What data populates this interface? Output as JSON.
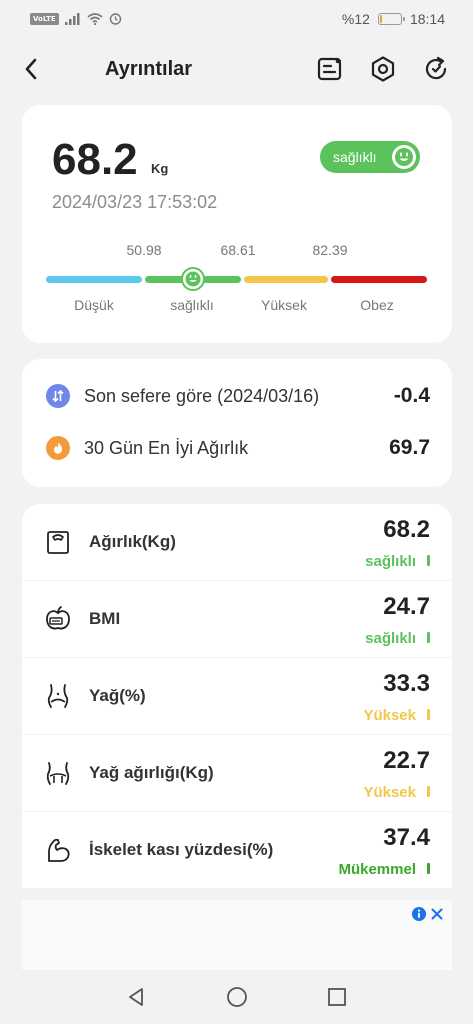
{
  "status_bar": {
    "network_badge": "VoLTE",
    "battery_text": "%12",
    "battery_level": 0.12,
    "time": "18:14"
  },
  "header": {
    "title": "Ayrıntılar",
    "icons": [
      "back-icon",
      "report-icon",
      "settings-hex-icon",
      "refresh-icon"
    ]
  },
  "summary": {
    "weight": "68.2",
    "unit": "Kg",
    "status_label": "sağlıklı",
    "datetime": "2024/03/23 17:53:02",
    "thresholds": [
      "50.98",
      "68.61",
      "82.39"
    ],
    "categories": [
      "Düşük",
      "sağlıklı",
      "Yüksek",
      "Obez"
    ],
    "category_colors": [
      "#5ec8ee",
      "#5cc25c",
      "#f2c64a",
      "#d41616"
    ],
    "marker_category": "sağlıklı",
    "marker_position": 0.5
  },
  "comparison": {
    "rows": [
      {
        "label": "Son sefere göre (2024/03/16)",
        "value": "-0.4",
        "icon": "compare-icon",
        "icon_color": "#6f86ea"
      },
      {
        "label": "30 Gün En İyi Ağırlık",
        "value": "69.7",
        "icon": "best-weight-icon",
        "icon_color": "#f39a3a"
      }
    ]
  },
  "metrics": [
    {
      "name": "Ağırlık(Kg)",
      "value": "68.2",
      "status": "sağlıklı",
      "status_color": "#5cc25c",
      "icon": "scale-icon"
    },
    {
      "name": "BMI",
      "value": "24.7",
      "status": "sağlıklı",
      "status_color": "#5cc25c",
      "icon": "bmi-icon"
    },
    {
      "name": "Yağ(%)",
      "value": "33.3",
      "status": "Yüksek",
      "status_color": "#f2c64a",
      "icon": "body-fat-icon"
    },
    {
      "name": "Yağ ağırlığı(Kg)",
      "value": "22.7",
      "status": "Yüksek",
      "status_color": "#f2c64a",
      "icon": "fat-weight-icon"
    },
    {
      "name": "İskelet kası yüzdesi(%)",
      "value": "37.4",
      "status": "Mükemmel",
      "status_color": "#3aa82a",
      "icon": "muscle-icon"
    }
  ],
  "ad": {
    "icons": [
      "ad-info-icon",
      "ad-close-icon"
    ],
    "accent": "#1a73e8"
  },
  "nav": {
    "icons": [
      "nav-back-icon",
      "nav-home-icon",
      "nav-recents-icon"
    ]
  }
}
